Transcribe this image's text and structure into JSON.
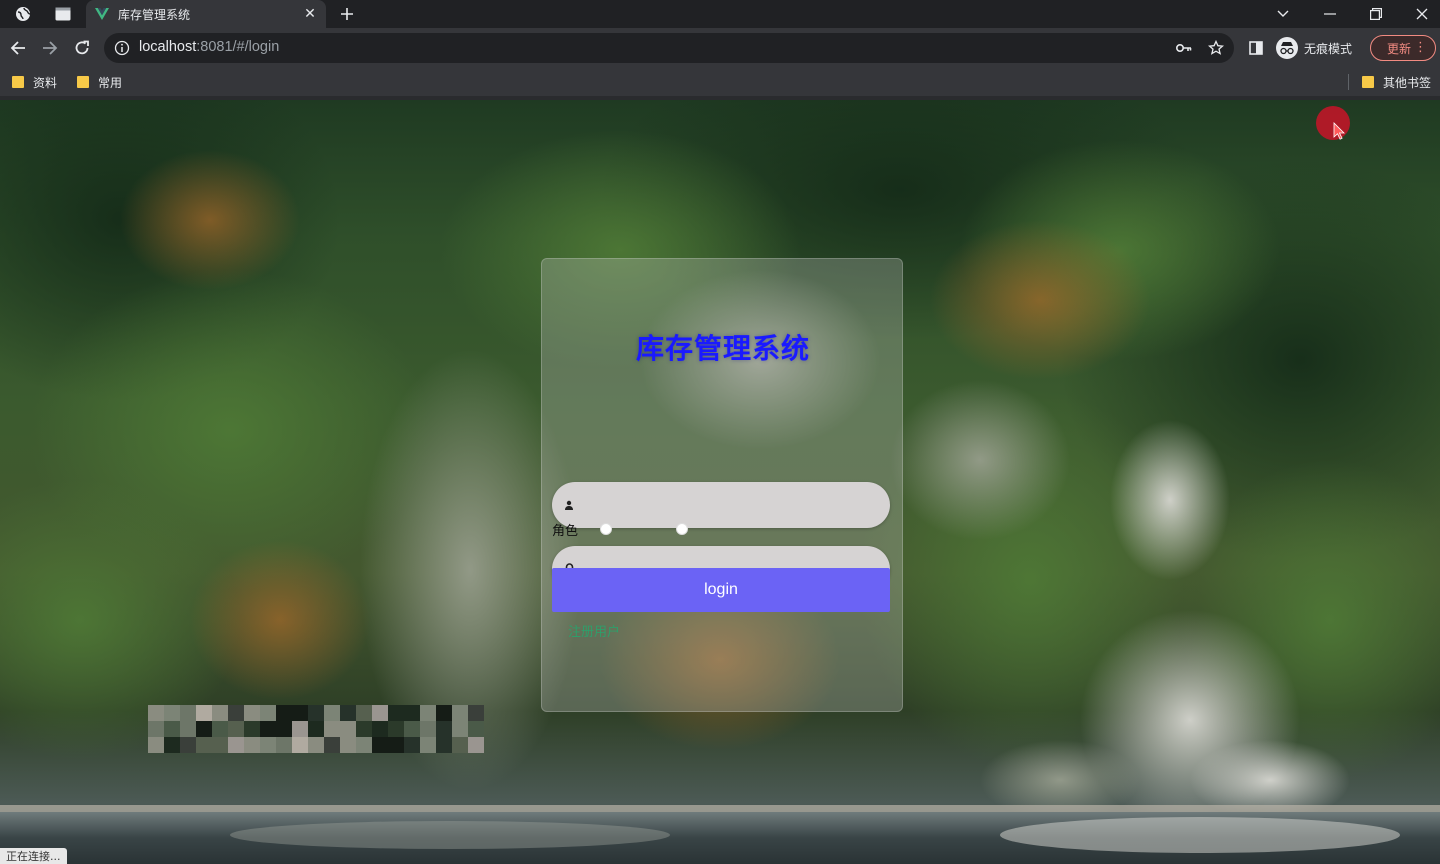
{
  "browser": {
    "tab_title": "库存管理系统",
    "url_host": "localhost",
    "url_rest": ":8081/#/login",
    "incognito_label": "无痕模式",
    "update_label": "更新",
    "bookmarks": [
      "资料",
      "常用"
    ],
    "other_bookmarks": "其他书签",
    "status_text": "正在连接..."
  },
  "login": {
    "title": "库存管理系统",
    "username_placeholder": "",
    "password_placeholder": "",
    "role_label": "角色",
    "role_options": [
      "",
      ""
    ],
    "submit_label": "login",
    "register_link": "注册用户"
  },
  "colors": {
    "title": "#1a1aff",
    "button": "#6b63f5",
    "field": "#d6d3d3",
    "register_link": "#2f9e6a"
  }
}
